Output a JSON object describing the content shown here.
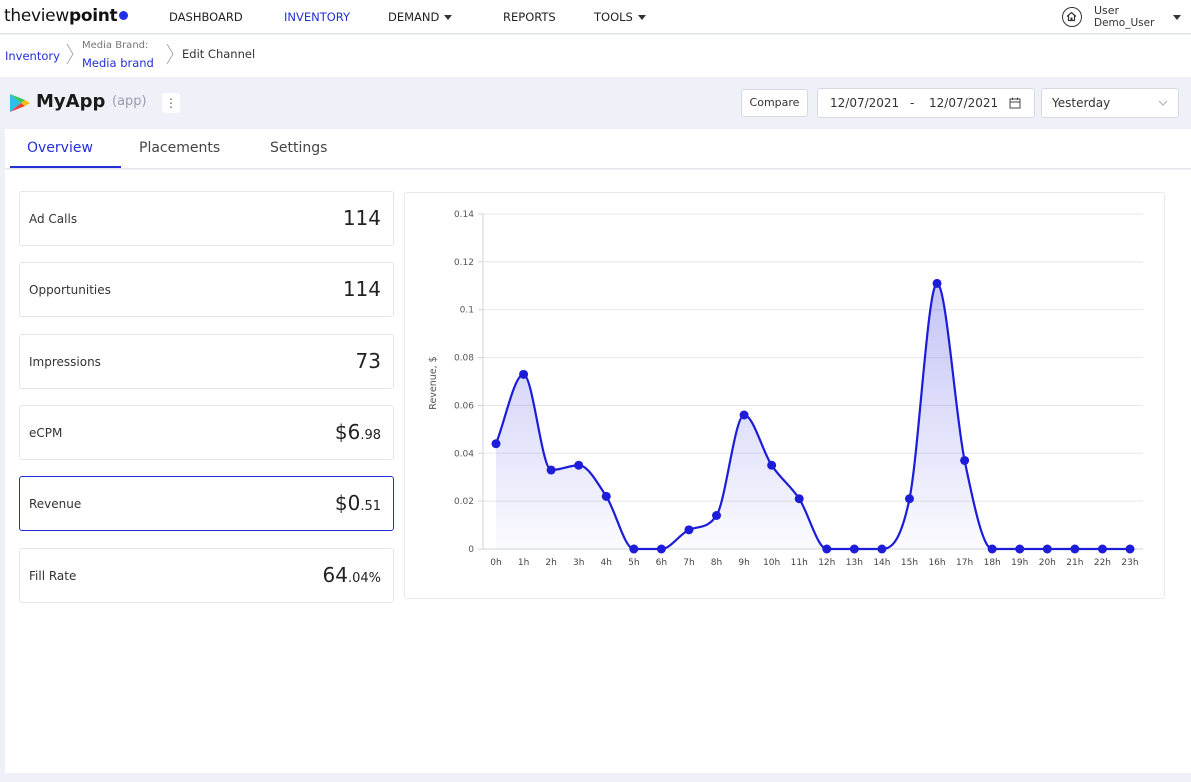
{
  "logo": {
    "part1": "the",
    "part2": "view",
    "part3": "point"
  },
  "nav": {
    "items": [
      {
        "label": "DASHBOARD"
      },
      {
        "label": "INVENTORY"
      },
      {
        "label": "DEMAND"
      },
      {
        "label": "REPORTS"
      },
      {
        "label": "TOOLS"
      }
    ],
    "active": "INVENTORY"
  },
  "user": {
    "label": "User",
    "name": "Demo_User"
  },
  "breadcrumb": {
    "root": "Inventory",
    "brand_caption": "Media Brand:",
    "brand": "Media brand",
    "current": "Edit Channel"
  },
  "app": {
    "name": "MyApp",
    "type": "(app)",
    "menu_glyph": "⋮"
  },
  "toolbar": {
    "compare_label": "Compare",
    "date_from": "12/07/2021",
    "date_separator": "-",
    "date_to": "12/07/2021",
    "period": "Yesterday"
  },
  "tabs": [
    {
      "label": "Overview",
      "active": true
    },
    {
      "label": "Placements",
      "active": false
    },
    {
      "label": "Settings",
      "active": false
    }
  ],
  "metrics": [
    {
      "label": "Ad Calls",
      "value": "114",
      "value_sub": ""
    },
    {
      "label": "Opportunities",
      "value": "114",
      "value_sub": ""
    },
    {
      "label": "Impressions",
      "value": "73",
      "value_sub": ""
    },
    {
      "label": "eCPM",
      "value": "$6",
      "value_sub": ".98"
    },
    {
      "label": "Revenue",
      "value": "$0",
      "value_sub": ".51",
      "selected": true
    },
    {
      "label": "Fill Rate",
      "value": "64",
      "value_sub": ".04%"
    }
  ],
  "colors": {
    "accent": "#2430d6",
    "line": "#1c1cd9",
    "background": "#eef1f7"
  },
  "chart_data": {
    "type": "area",
    "ylabel": "Revenue, $",
    "xlabel": "",
    "ylim": [
      0,
      0.14
    ],
    "y_ticks": [
      "0",
      "0.02",
      "0.04",
      "0.06",
      "0.08",
      "0.1",
      "0.12",
      "0.14"
    ],
    "grid": true,
    "legend": "none",
    "x": [
      "0h",
      "1h",
      "2h",
      "3h",
      "4h",
      "5h",
      "6h",
      "7h",
      "8h",
      "9h",
      "10h",
      "11h",
      "12h",
      "13h",
      "14h",
      "15h",
      "16h",
      "17h",
      "18h",
      "19h",
      "20h",
      "21h",
      "22h",
      "23h"
    ],
    "values": [
      0.044,
      0.073,
      0.033,
      0.035,
      0.022,
      0,
      0,
      0.008,
      0.014,
      0.056,
      0.035,
      0.021,
      0,
      0,
      0,
      0.021,
      0.111,
      0.037,
      0,
      0,
      0,
      0,
      0,
      0
    ]
  }
}
